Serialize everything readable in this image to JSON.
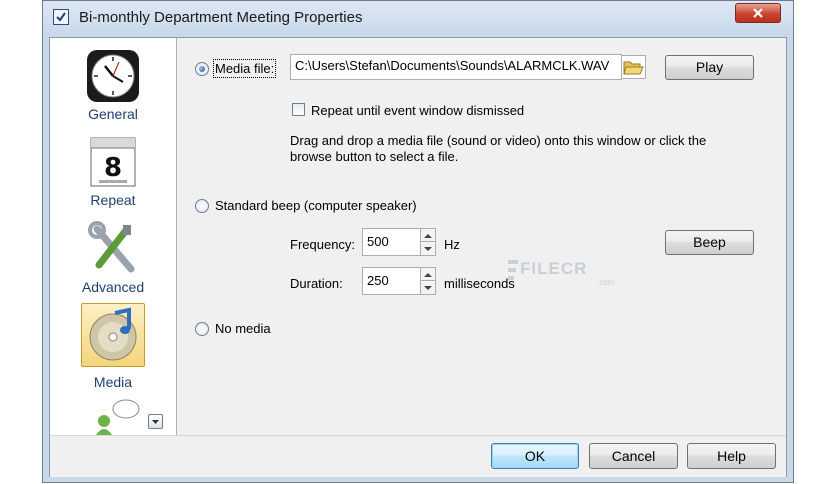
{
  "window": {
    "title": "Bi-monthly Department Meeting Properties"
  },
  "sidebar": {
    "items": [
      {
        "label": "General",
        "icon": "clock-icon"
      },
      {
        "label": "Repeat",
        "icon": "calendar-icon"
      },
      {
        "label": "Advanced",
        "icon": "tools-icon"
      },
      {
        "label": "Media",
        "icon": "media-disc-icon",
        "selected": true
      }
    ]
  },
  "media": {
    "media_file_label": "Media file:",
    "media_file_path": "C:\\Users\\Stefan\\Documents\\Sounds\\ALARMCLK.WAV",
    "play_label": "Play",
    "repeat_label": "Repeat until event window dismissed",
    "hint": "Drag and drop a media file (sound or video) onto this window or click the browse button to select a file.",
    "beep_option_label": "Standard beep (computer speaker)",
    "frequency_label": "Frequency:",
    "frequency_value": "500",
    "frequency_unit": "Hz",
    "beep_button": "Beep",
    "duration_label": "Duration:",
    "duration_value": "250",
    "duration_unit": "milliseconds",
    "no_media_label": "No media",
    "selected_option": "media-file",
    "repeat_checked": false
  },
  "buttons": {
    "ok": "OK",
    "cancel": "Cancel",
    "help": "Help"
  },
  "watermark": {
    "text": "FILECR",
    "sub": ".com"
  },
  "colors": {
    "selected_bg": "#f5d57a",
    "label_blue": "#1e3f73",
    "close_red": "#c9442e"
  }
}
